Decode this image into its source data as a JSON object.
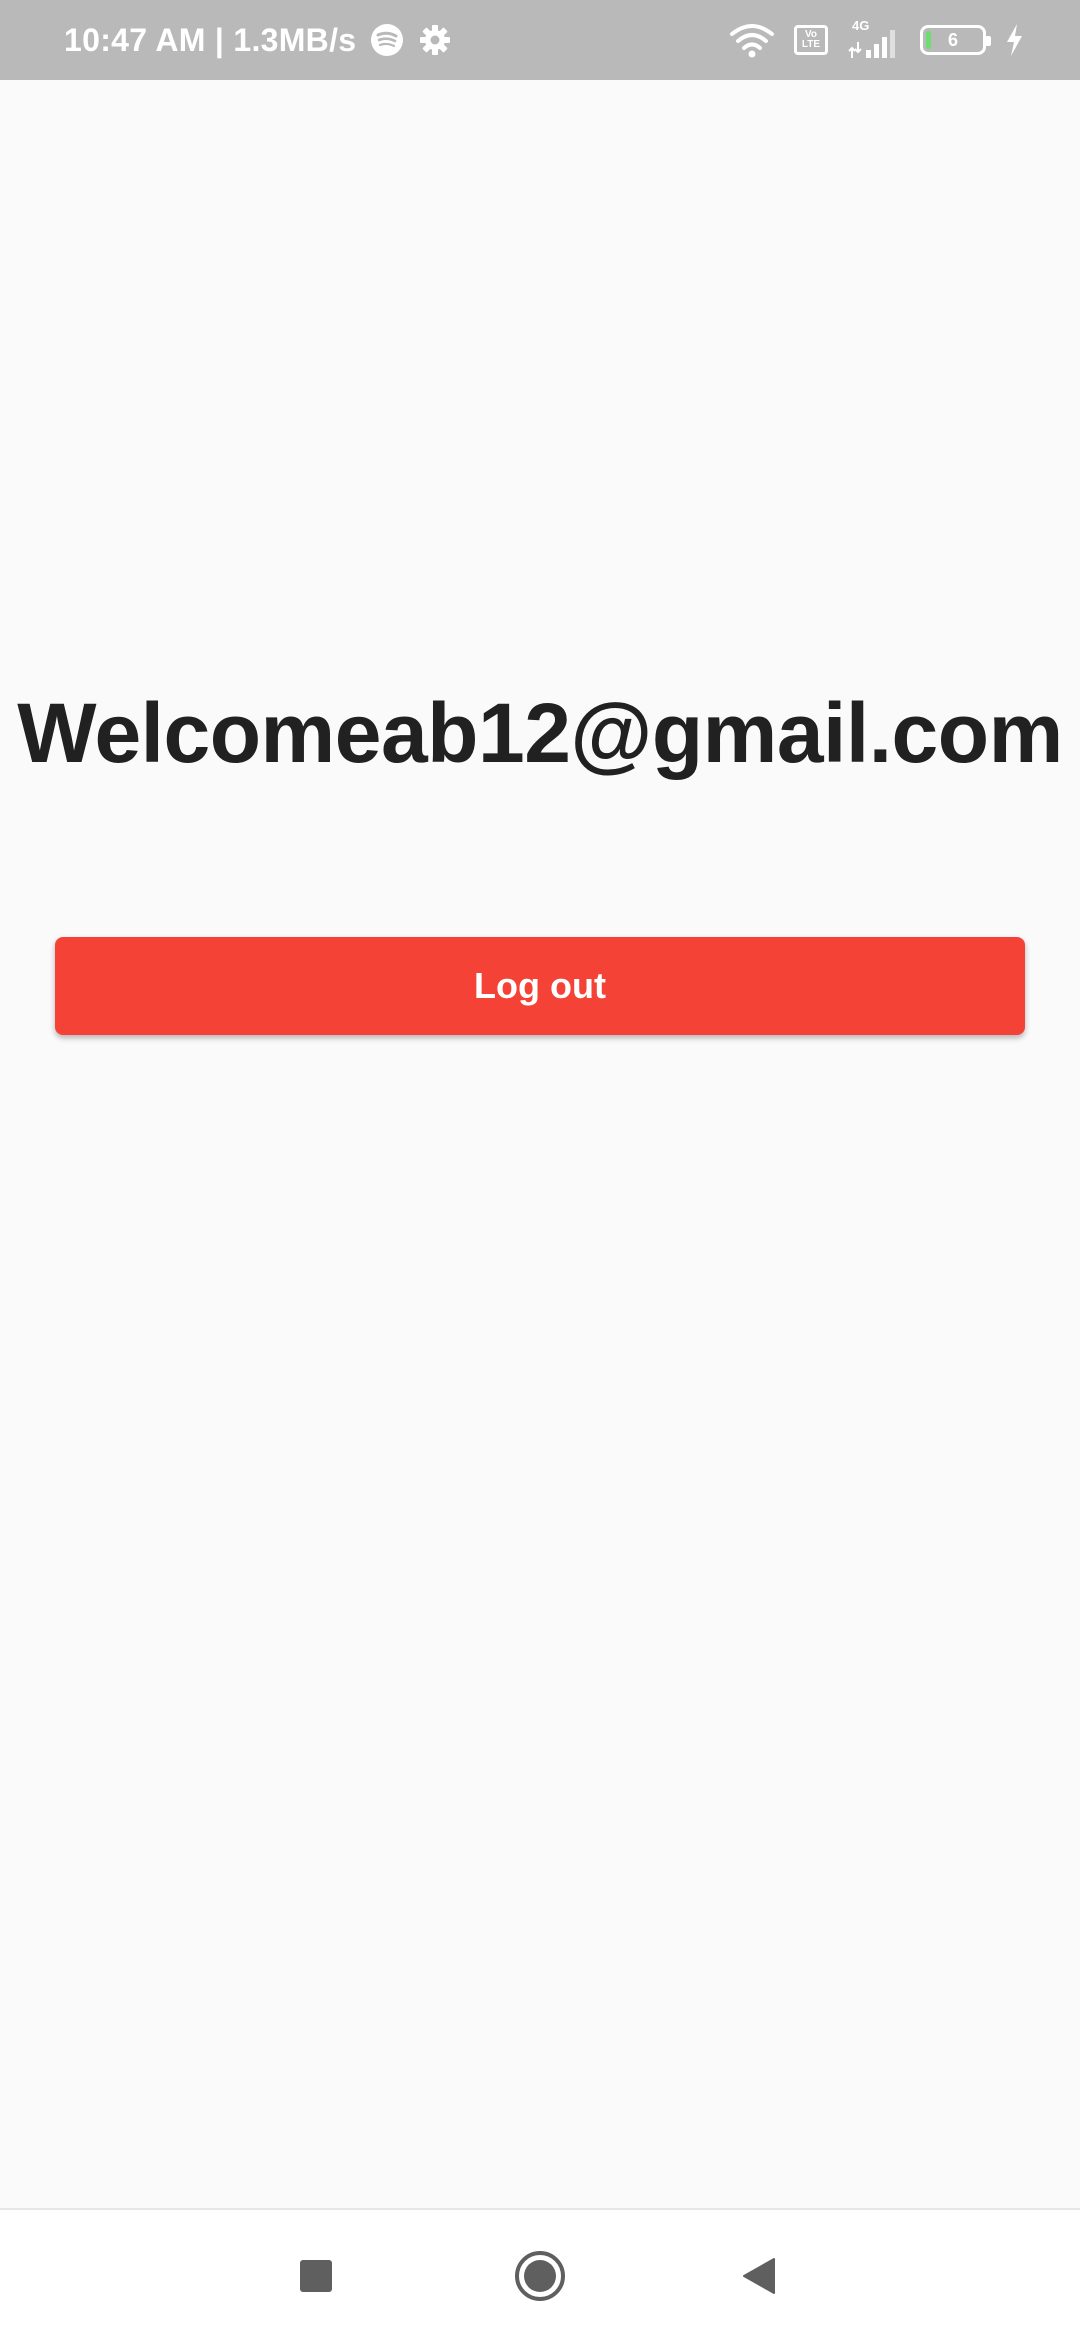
{
  "status_bar": {
    "time_speed": "10:47 AM | 1.3MB/s",
    "network_type": "4G",
    "volte_top": "Vo",
    "volte_bottom": "LTE",
    "battery_level": "6",
    "icons": [
      "spotify-icon",
      "settings-gear-icon",
      "wifi-icon",
      "volte-icon",
      "signal-icon",
      "battery-icon",
      "charging-icon"
    ]
  },
  "main": {
    "welcome_text": "Welcomeab12@gmail.com",
    "logout_label": "Log out"
  },
  "nav_bar": {
    "icons": [
      "recents-square-icon",
      "home-circle-icon",
      "back-triangle-icon"
    ]
  },
  "colors": {
    "status_bar_bg": "#b9b9b9",
    "background": "#fafafa",
    "button": "#f44336",
    "text": "#212121"
  }
}
